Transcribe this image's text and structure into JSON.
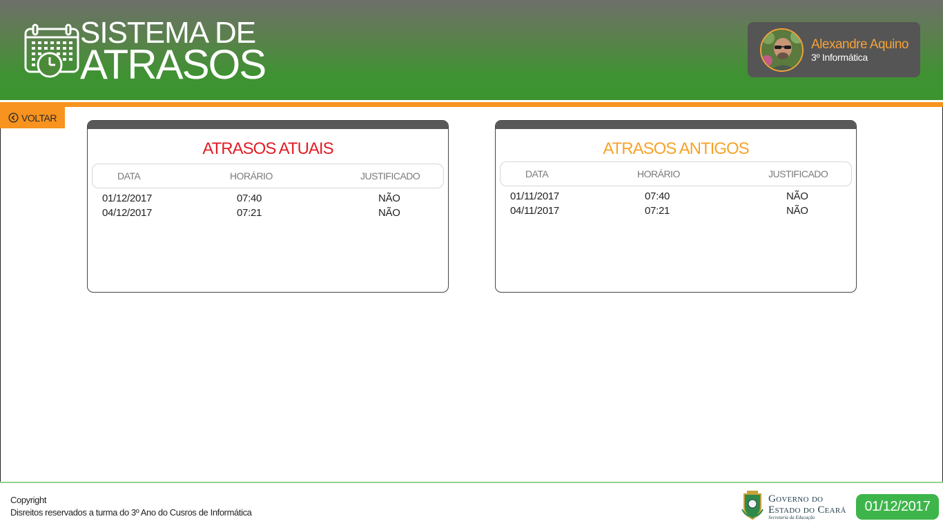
{
  "header": {
    "logo_line1": "SISTEMA DE",
    "logo_line2": "ATRASOS",
    "user_name": "Alexandre Aquino",
    "user_class": "3º Informática"
  },
  "nav": {
    "back_label": "VOLTAR"
  },
  "panels": [
    {
      "title": "ATRASOS ATUAIS",
      "title_color": "#e21d25",
      "columns": [
        "DATA",
        "HORÁRIO",
        "JUSTIFICADO"
      ],
      "rows": [
        {
          "data": "01/12/2017",
          "horario": "07:40",
          "justificado": "NÃO"
        },
        {
          "data": "04/12/2017",
          "horario": "07:21",
          "justificado": "NÃO"
        }
      ]
    },
    {
      "title": "ATRASOS ANTIGOS",
      "title_color": "#f7a329",
      "columns": [
        "DATA",
        "HORÁRIO",
        "JUSTIFICADO"
      ],
      "rows": [
        {
          "data": "01/11/2017",
          "horario": "07:40",
          "justificado": "NÃO"
        },
        {
          "data": "04/11/2017",
          "horario": "07:21",
          "justificado": "NÃO"
        }
      ]
    }
  ],
  "footer": {
    "copyright": "Copyright",
    "rights": "Disreitos reservados a turma do 3º Ano do Cusros de Informática",
    "gov_line1": "Governo do",
    "gov_line2": "Estado do Ceará",
    "gov_line3": "Secretaria da Educação",
    "date": "01/12/2017"
  },
  "colors": {
    "accent_orange": "#f7931e",
    "header_green": "#3b9430",
    "date_badge_green": "#3db54a",
    "user_card_bg": "#555555"
  },
  "icons": [
    "calendar-clock-icon",
    "chevron-left-circle-icon",
    "ceara-coat-of-arms-icon"
  ]
}
